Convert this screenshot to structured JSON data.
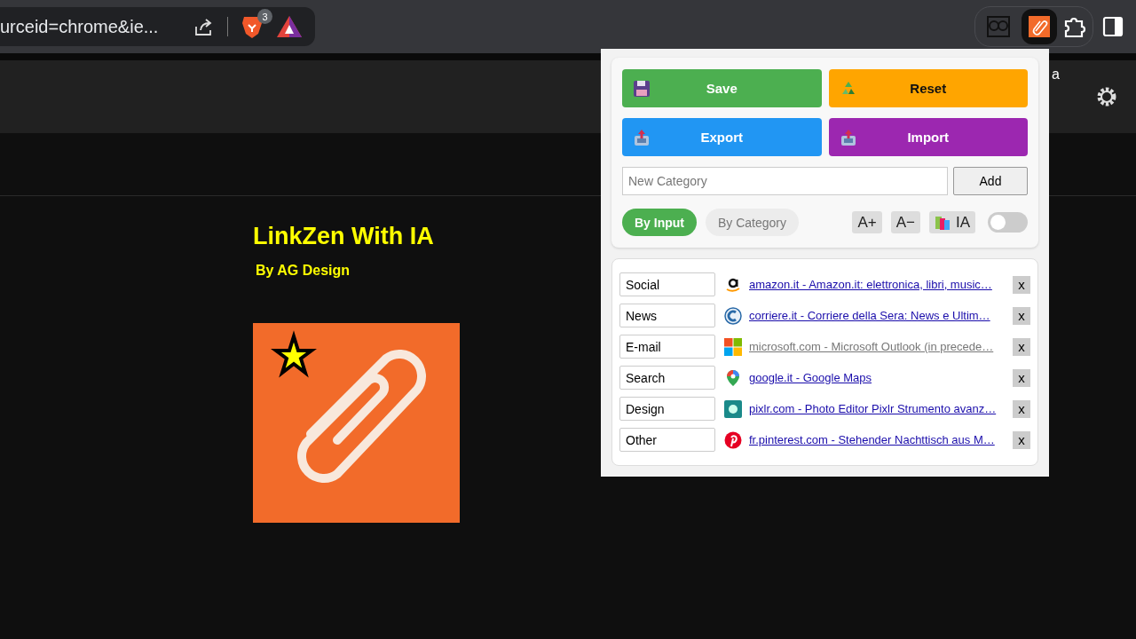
{
  "browser": {
    "address_text": "urceid=chrome&ie...",
    "shields_badge": "3"
  },
  "page": {
    "header_fragment": "a",
    "title": "LinkZen With IA",
    "subtitle": "By AG Design"
  },
  "popup": {
    "buttons": [
      {
        "label": "Save",
        "kind": "save"
      },
      {
        "label": "Reset",
        "kind": "reset"
      },
      {
        "label": "Export",
        "kind": "export"
      },
      {
        "label": "Import",
        "kind": "import"
      }
    ],
    "category_field": {
      "placeholder": "New Category"
    },
    "add_button": "Add",
    "tabs": [
      {
        "label": "By Input",
        "selected": true
      },
      {
        "label": "By Category",
        "selected": false
      }
    ],
    "font_buttons": [
      "A+",
      "A−"
    ],
    "ia_button": "IA",
    "ia_toggle": {
      "on": false
    },
    "links": [
      {
        "category": "Social",
        "link": "amazon.it - Amazon.it: elettronica, libri, music…",
        "visited": false,
        "remove": "x"
      },
      {
        "category": "News",
        "link": "corriere.it - Corriere della Sera: News e Ultim…",
        "visited": false,
        "remove": "x"
      },
      {
        "category": "E-mail",
        "link": "microsoft.com - Microsoft Outlook (in precede…",
        "visited": true,
        "remove": "x"
      },
      {
        "category": "Search",
        "link": "google.it - Google Maps",
        "visited": false,
        "remove": "x"
      },
      {
        "category": "Design",
        "link": "pixlr.com - Photo Editor Pixlr Strumento avanz…",
        "visited": false,
        "remove": "x"
      },
      {
        "category": "Other",
        "link": "fr.pinterest.com - Stehender Nachttisch aus M…",
        "visited": false,
        "remove": "x"
      }
    ]
  }
}
